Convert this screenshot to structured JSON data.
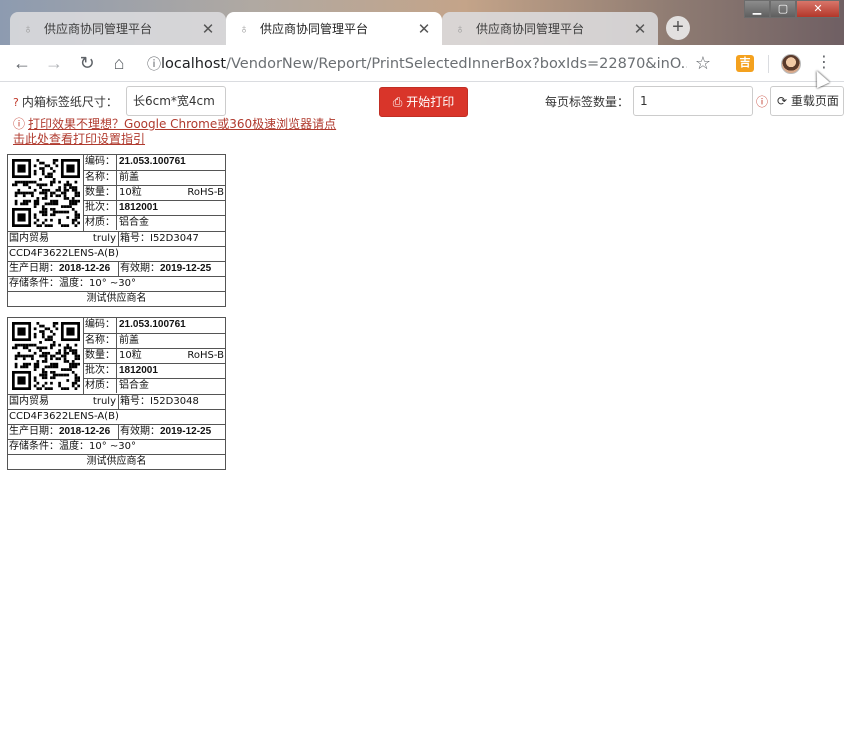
{
  "browser": {
    "tabs": [
      {
        "title": "供应商协同管理平台",
        "active": false
      },
      {
        "title": "供应商协同管理平台",
        "active": true
      },
      {
        "title": "供应商协同管理平台",
        "active": false
      }
    ],
    "url_host": "localhost",
    "url_path": "/VendorNew/Report/PrintSelectedInnerBox?boxIds=22870&inO...",
    "ext_glyph": "吉"
  },
  "controls": {
    "size_label": "内箱标签纸尺寸：",
    "size_value": "长6cm*宽4cm",
    "print_label": "开始打印",
    "count_label": "每页标签数量：",
    "count_value": "1",
    "reload_label": "重载页面",
    "tip_text": "打印效果不理想？Google Chrome或360极速浏览器请点击此处查看打印设置指引"
  },
  "label_fields": {
    "code": "编码：",
    "name": "名称：",
    "qty": "数量：",
    "batch": "批次：",
    "material": "材质："
  },
  "labels": [
    {
      "code": "21.053.100761",
      "name": "前盖",
      "qty": "10粒",
      "rohs": "RoHS-B",
      "batch": "1812001",
      "material": "铝合金",
      "trade": "国内贸易",
      "brand": "truly",
      "box_no": "箱号：I52D3047",
      "part": "CCD4F3622LENS-A(B)",
      "prod_label": "生产日期：",
      "prod_date": "2018-12-26",
      "exp_label": "有效期：",
      "exp_date": "2019-12-25",
      "storage": "存储条件：温度：10° ~30°",
      "supplier": "测试供应商名"
    },
    {
      "code": "21.053.100761",
      "name": "前盖",
      "qty": "10粒",
      "rohs": "RoHS-B",
      "batch": "1812001",
      "material": "铝合金",
      "trade": "国内贸易",
      "brand": "truly",
      "box_no": "箱号：I52D3048",
      "part": "CCD4F3622LENS-A(B)",
      "prod_label": "生产日期：",
      "prod_date": "2018-12-26",
      "exp_label": "有效期：",
      "exp_date": "2019-12-25",
      "storage": "存储条件：温度：10° ~30°",
      "supplier": "测试供应商名"
    }
  ]
}
